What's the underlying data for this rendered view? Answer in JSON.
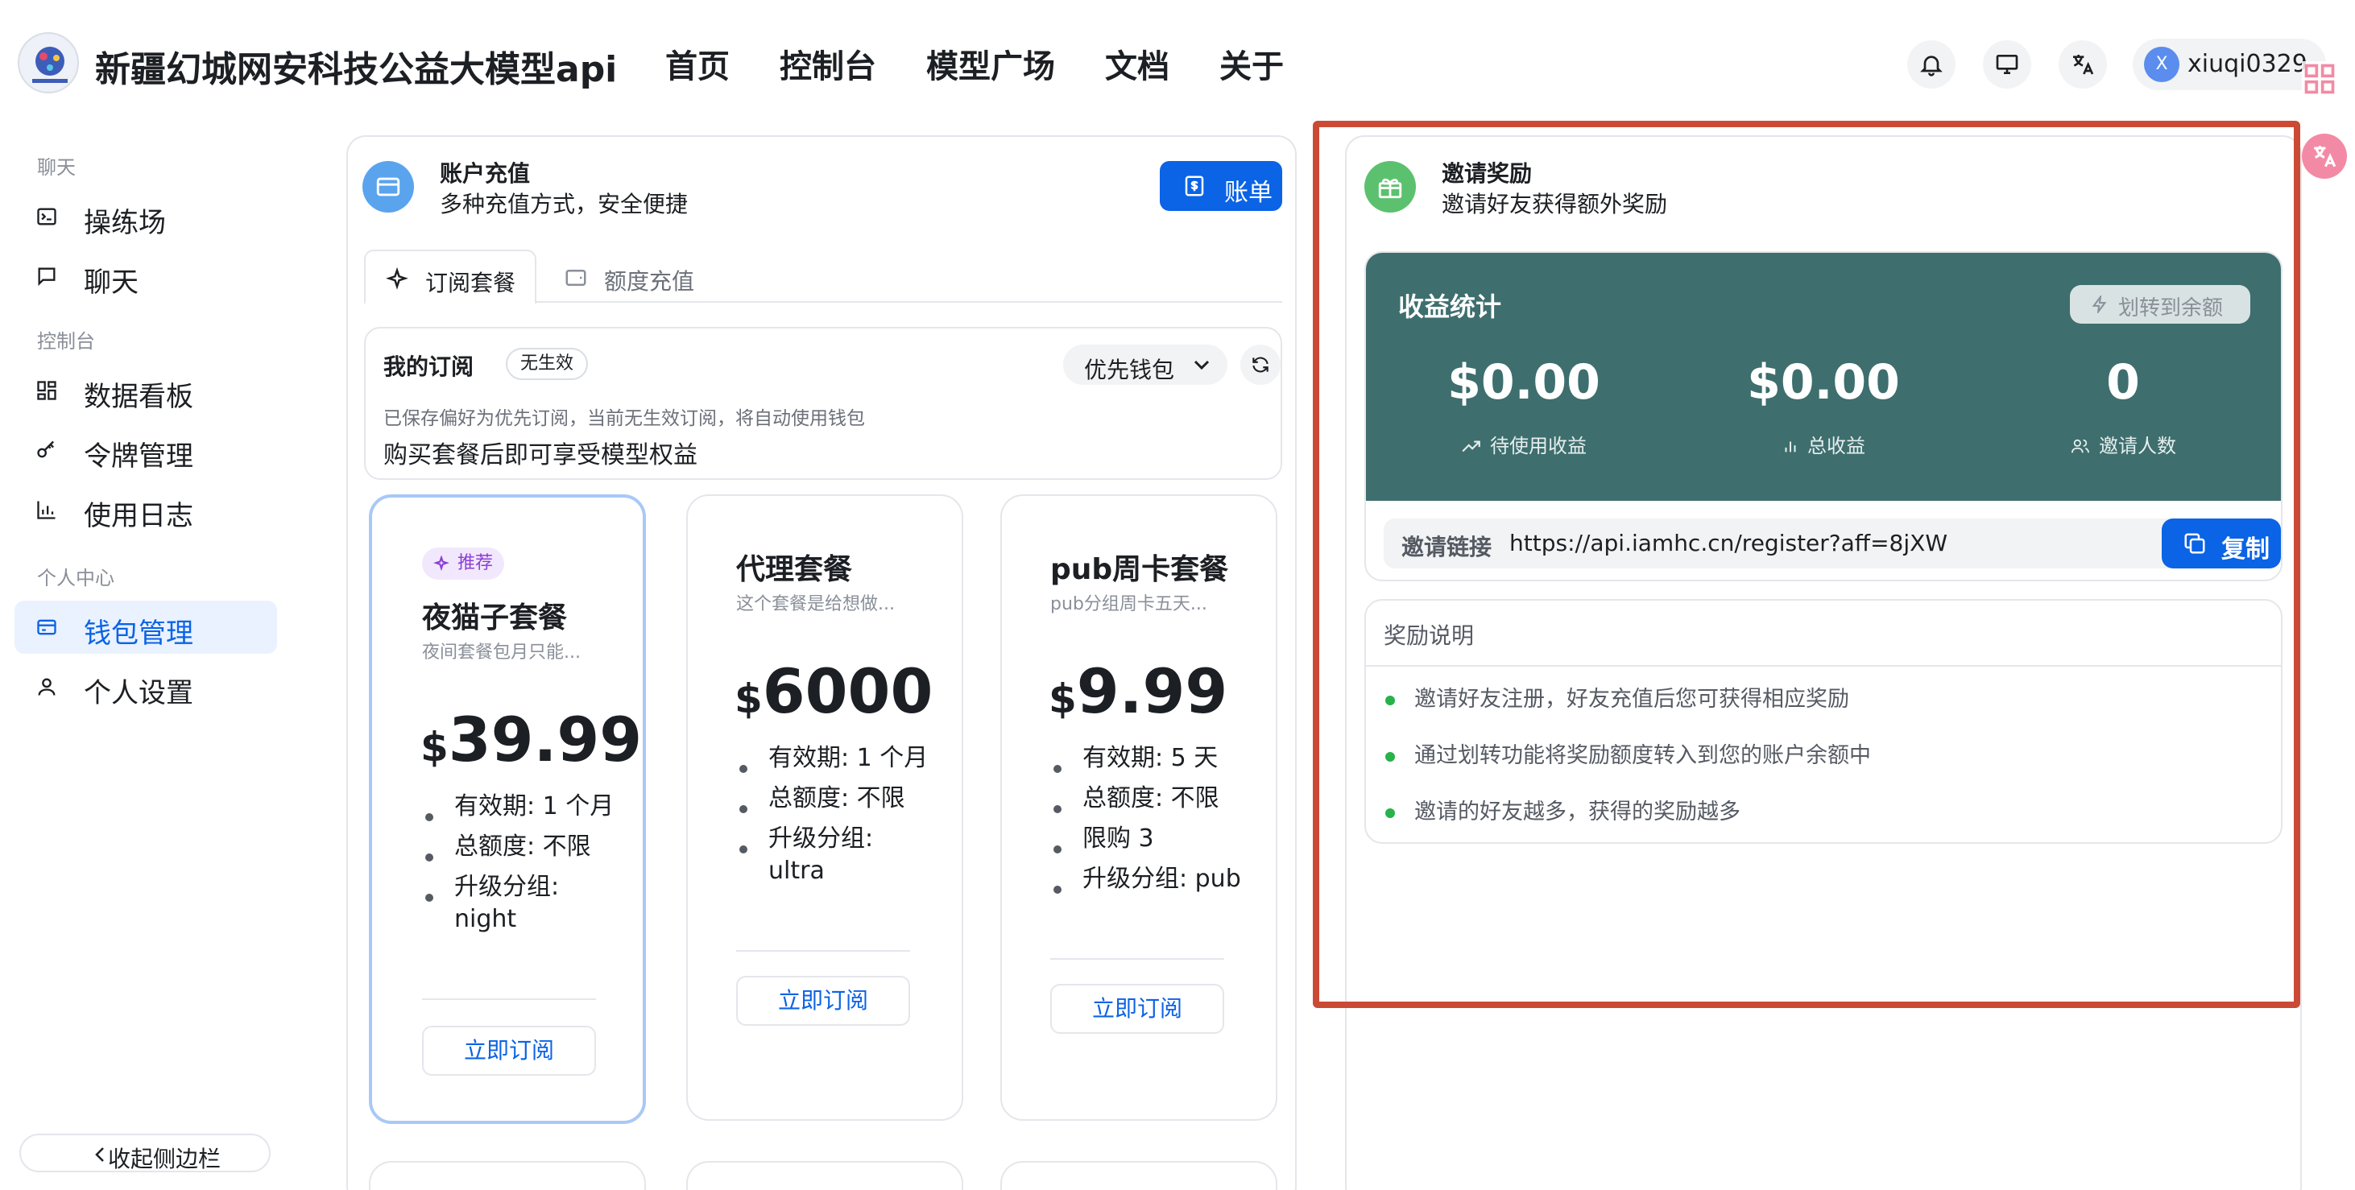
{
  "header": {
    "site_title": "新疆幻城网安科技公益大模型api",
    "nav": [
      "首页",
      "控制台",
      "模型广场",
      "文档",
      "关于"
    ],
    "user": {
      "avatar_letter": "X",
      "username": "xiuqi0329"
    }
  },
  "sidebar": {
    "groups": [
      "聊天",
      "控制台",
      "个人中心"
    ],
    "items": [
      {
        "label": "操练场",
        "icon": "terminal-icon"
      },
      {
        "label": "聊天",
        "icon": "chat-icon"
      },
      {
        "label": "数据看板",
        "icon": "dashboard-icon"
      },
      {
        "label": "令牌管理",
        "icon": "key-icon"
      },
      {
        "label": "使用日志",
        "icon": "bar-chart-icon"
      },
      {
        "label": "钱包管理",
        "icon": "wallet-icon",
        "active": true
      },
      {
        "label": "个人设置",
        "icon": "user-icon"
      }
    ],
    "collapse_label": "收起侧边栏"
  },
  "recharge": {
    "title": "账户充值",
    "subtitle": "多种充值方式，安全便捷",
    "bill_button": "账单",
    "tabs": [
      "订阅套餐",
      "额度充值"
    ],
    "my_sub": {
      "title": "我的订阅",
      "status": "无生效",
      "wallet_select": "优先钱包",
      "note": "已保存偏好为优先订阅，当前无生效订阅，将自动使用钱包",
      "desc": "购买套餐后即可享受模型权益"
    },
    "plans": [
      {
        "badge": "推荐",
        "name": "夜猫子套餐",
        "desc": "夜间套餐包月只能...",
        "currency": "$",
        "price": "39.99",
        "features": [
          "有效期: 1 个月",
          "总额度: 不限",
          "升级分组: night"
        ],
        "button": "立即订阅"
      },
      {
        "name": "代理套餐",
        "desc": "这个套餐是给想做...",
        "currency": "$",
        "price": "6000",
        "features": [
          "有效期: 1 个月",
          "总额度: 不限",
          "升级分组: ultra"
        ],
        "button": "立即订阅"
      },
      {
        "name": "pub周卡套餐",
        "desc": "pub分组周卡五天...",
        "currency": "$",
        "price": "9.99",
        "features": [
          "有效期: 5 天",
          "总额度: 不限",
          "限购 3",
          "升级分组: pub"
        ],
        "button": "立即订阅"
      }
    ]
  },
  "invite": {
    "title": "邀请奖励",
    "subtitle": "邀请好友获得额外奖励",
    "earnings_title": "收益统计",
    "transfer_button": "划转到余额",
    "stats": [
      {
        "value": "$0.00",
        "label": "待使用收益",
        "icon": "trend-up-icon"
      },
      {
        "value": "$0.00",
        "label": "总收益",
        "icon": "bar-chart-icon"
      },
      {
        "value": "0",
        "label": "邀请人数",
        "icon": "users-icon"
      }
    ],
    "link_label": "邀请链接",
    "link_value": "https://api.iamhc.cn/register?aff=8jXW",
    "copy_button": "复制",
    "rules_title": "奖励说明",
    "rules": [
      "邀请好友注册，好友充值后您可获得相应奖励",
      "通过划转功能将奖励额度转入到您的账户余额中",
      "邀请的好友越多，获得的奖励越多"
    ]
  },
  "colors": {
    "primary": "#0b63e5",
    "earnings_bg": "#3e6e6e",
    "highlight": "#cb4a35",
    "rule_dot": "#27b24a",
    "badge_purple": "#8b3ed6"
  }
}
